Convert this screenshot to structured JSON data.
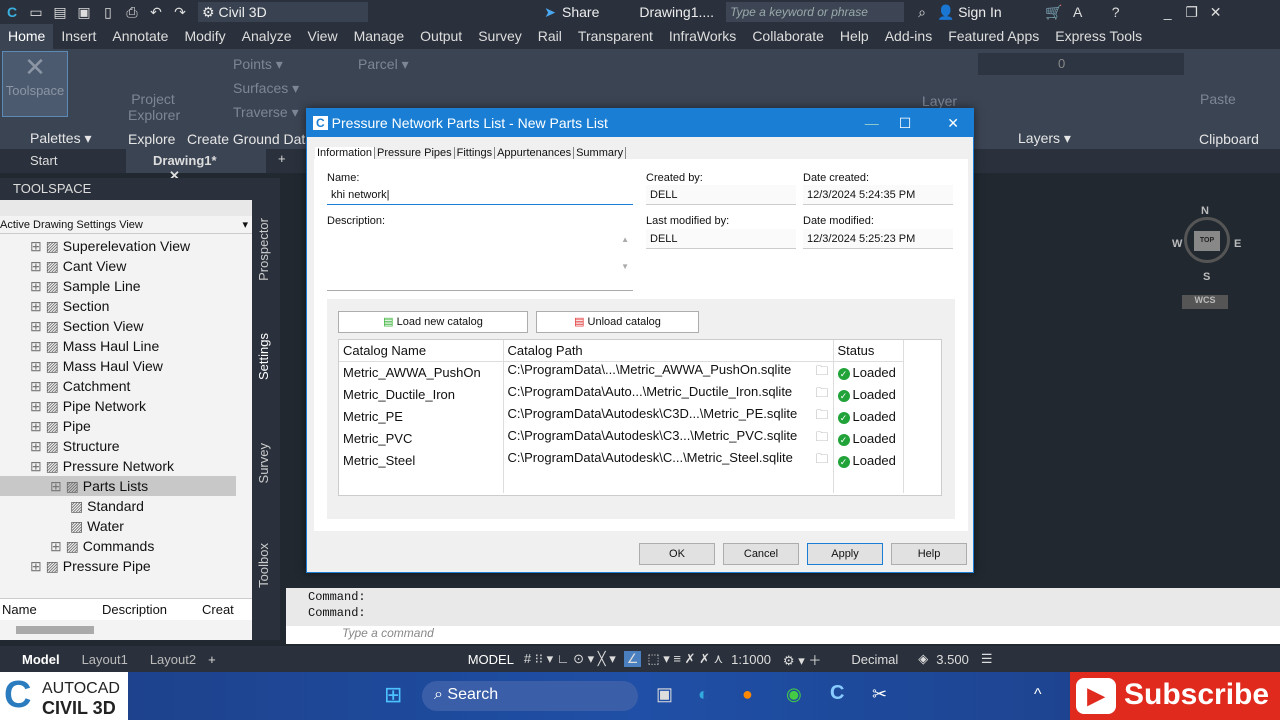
{
  "app": {
    "workspace": "Civil 3D",
    "share": "Share",
    "doc_title": "Drawing1....",
    "search_placeholder": "Type a keyword or phrase",
    "sign_in": "Sign In"
  },
  "ribbon_tabs": [
    "Home",
    "Insert",
    "Annotate",
    "Modify",
    "Analyze",
    "View",
    "Manage",
    "Output",
    "Survey",
    "Rail",
    "Transparent",
    "InfraWorks",
    "Collaborate",
    "Help",
    "Add-ins",
    "Featured Apps",
    "Express Tools"
  ],
  "ribbon": {
    "toolspace": "Toolspace",
    "project_explorer": "Project Explorer",
    "points": "Points",
    "surfaces": "Surfaces",
    "traverse": "Traverse",
    "parcel": "Parcel",
    "layer": "Layer",
    "layer_value": "0",
    "paste": "Paste",
    "panels": {
      "palettes": "Palettes",
      "explore": "Explore",
      "create_ground": "Create Ground Data",
      "layers": "Layers",
      "clipboard": "Clipboard"
    }
  },
  "doc_tabs": {
    "start": "Start",
    "drawing": "Drawing1*"
  },
  "toolspace": {
    "title": "TOOLSPACE",
    "view": "Active Drawing Settings View",
    "items": [
      {
        "label": "Superelevation View",
        "indent": 0
      },
      {
        "label": "Cant View",
        "indent": 0
      },
      {
        "label": "Sample Line",
        "indent": 0
      },
      {
        "label": "Section",
        "indent": 0
      },
      {
        "label": "Section View",
        "indent": 0
      },
      {
        "label": "Mass Haul Line",
        "indent": 0
      },
      {
        "label": "Mass Haul View",
        "indent": 0
      },
      {
        "label": "Catchment",
        "indent": 0
      },
      {
        "label": "Pipe Network",
        "indent": 0
      },
      {
        "label": "Pipe",
        "indent": 0
      },
      {
        "label": "Structure",
        "indent": 0
      },
      {
        "label": "Pressure Network",
        "indent": 0
      },
      {
        "label": "Parts Lists",
        "indent": 1
      },
      {
        "label": "Standard",
        "indent": 2
      },
      {
        "label": "Water",
        "indent": 2
      },
      {
        "label": "Commands",
        "indent": 1
      },
      {
        "label": "Pressure Pipe",
        "indent": 0
      }
    ],
    "columns": [
      "Name",
      "Description",
      "Creat"
    ],
    "vertical_tabs": [
      "Prospector",
      "Settings",
      "Survey",
      "Toolbox"
    ]
  },
  "dialog": {
    "title": "Pressure Network Parts List - New Parts List",
    "tabs": [
      "Information",
      "Pressure Pipes",
      "Fittings",
      "Appurtenances",
      "Summary"
    ],
    "name_label": "Name:",
    "name_value": "khi network",
    "description_label": "Description:",
    "created_by_label": "Created by:",
    "created_by": "DELL",
    "date_created_label": "Date created:",
    "date_created": "12/3/2024 5:24:35 PM",
    "modified_by_label": "Last modified by:",
    "modified_by": "DELL",
    "date_modified_label": "Date modified:",
    "date_modified": "12/3/2024 5:25:23 PM",
    "load_catalog": "Load new catalog",
    "unload_catalog": "Unload catalog",
    "table_headers": [
      "Catalog Name",
      "Catalog Path",
      "Status"
    ],
    "rows": [
      [
        "Metric_AWWA_PushOn",
        "C:\\ProgramData\\...\\Metric_AWWA_PushOn.sqlite",
        "Loaded"
      ],
      [
        "Metric_Ductile_Iron",
        "C:\\ProgramData\\Auto...\\Metric_Ductile_Iron.sqlite",
        "Loaded"
      ],
      [
        "Metric_PE",
        "C:\\ProgramData\\Autodesk\\C3D...\\Metric_PE.sqlite",
        "Loaded"
      ],
      [
        "Metric_PVC",
        "C:\\ProgramData\\Autodesk\\C3...\\Metric_PVC.sqlite",
        "Loaded"
      ],
      [
        "Metric_Steel",
        "C:\\ProgramData\\Autodesk\\C...\\Metric_Steel.sqlite",
        "Loaded"
      ]
    ],
    "ok": "OK",
    "cancel": "Cancel",
    "apply": "Apply",
    "help": "Help"
  },
  "viewcube": {
    "n": "N",
    "s": "S",
    "e": "E",
    "w": "W",
    "top": "TOP",
    "wcs": "WCS"
  },
  "command": {
    "line1": "Command:",
    "line2": "Command:",
    "placeholder": "Type a command"
  },
  "status": {
    "model_tab": "Model",
    "layout1": "Layout1",
    "layout2": "Layout2",
    "model": "MODEL",
    "scale": "1:1000",
    "units": "Decimal",
    "value": "3.500"
  },
  "taskbar": {
    "logo_top": "AUTOCAD",
    "logo_bottom": "CIVIL 3D",
    "search": "Search",
    "subscribe": "Subscribe"
  }
}
